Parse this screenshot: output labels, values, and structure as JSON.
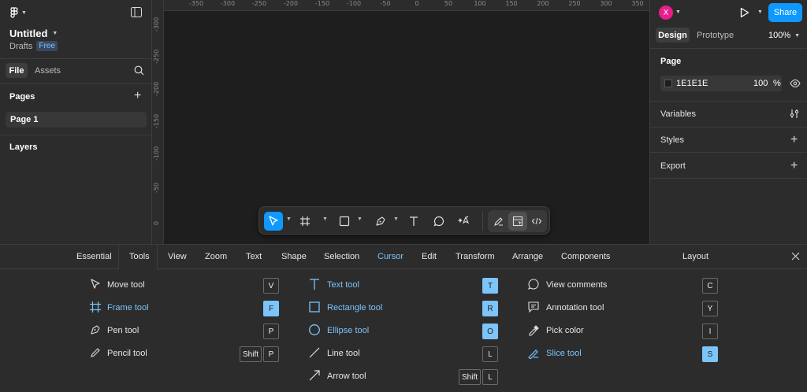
{
  "app": {
    "file_title": "Untitled",
    "location": "Drafts",
    "plan_badge": "Free"
  },
  "left_panel": {
    "tabs": [
      "File",
      "Assets"
    ],
    "pages_label": "Pages",
    "pages": [
      "Page 1"
    ],
    "layers_label": "Layers"
  },
  "canvas": {
    "h_ruler": [
      "-350",
      "-300",
      "-250",
      "-200",
      "-150",
      "-100",
      "-50",
      "0",
      "50",
      "100",
      "150",
      "200",
      "250",
      "300",
      "350"
    ],
    "v_ruler": [
      "-300",
      "-250",
      "-200",
      "-150",
      "-100",
      "-50",
      "0"
    ]
  },
  "right_panel": {
    "avatar_letter": "X",
    "share_label": "Share",
    "tabs": [
      "Design",
      "Prototype"
    ],
    "zoom": "100%",
    "page_section": "Page",
    "bg_color_hex": "1E1E1E",
    "bg_opacity": "100",
    "bg_opacity_unit": "%",
    "variables_label": "Variables",
    "styles_label": "Styles",
    "export_label": "Export"
  },
  "shortcuts_panel": {
    "tabs": [
      "Essential",
      "Tools",
      "View",
      "Zoom",
      "Text",
      "Shape",
      "Selection",
      "Cursor",
      "Edit",
      "Transform",
      "Arrange",
      "Components"
    ],
    "active_tab": "Tools",
    "layout_label": "Layout",
    "col1": [
      {
        "label": "Move tool",
        "keys": [
          "V"
        ]
      },
      {
        "label": "Frame tool",
        "keys": [
          "F"
        ],
        "highlight": true
      },
      {
        "label": "Pen tool",
        "keys": [
          "P"
        ]
      },
      {
        "label": "Pencil tool",
        "keys": [
          "Shift",
          "P"
        ]
      }
    ],
    "col2": [
      {
        "label": "Text tool",
        "keys": [
          "T"
        ],
        "highlight": true
      },
      {
        "label": "Rectangle tool",
        "keys": [
          "R"
        ],
        "highlight": true
      },
      {
        "label": "Ellipse tool",
        "keys": [
          "O"
        ],
        "highlight": true
      },
      {
        "label": "Line tool",
        "keys": [
          "L"
        ]
      },
      {
        "label": "Arrow tool",
        "keys": [
          "Shift",
          "L"
        ]
      }
    ],
    "col3": [
      {
        "label": "View comments",
        "keys": [
          "C"
        ]
      },
      {
        "label": "Annotation tool",
        "keys": [
          "Y"
        ]
      },
      {
        "label": "Pick color",
        "keys": [
          "I"
        ]
      },
      {
        "label": "Slice tool",
        "keys": [
          "S"
        ],
        "highlight": true
      }
    ]
  },
  "colors": {
    "accent": "#0d99ff",
    "highlight": "#7cc4fa",
    "avatar": "#e91e8c"
  }
}
